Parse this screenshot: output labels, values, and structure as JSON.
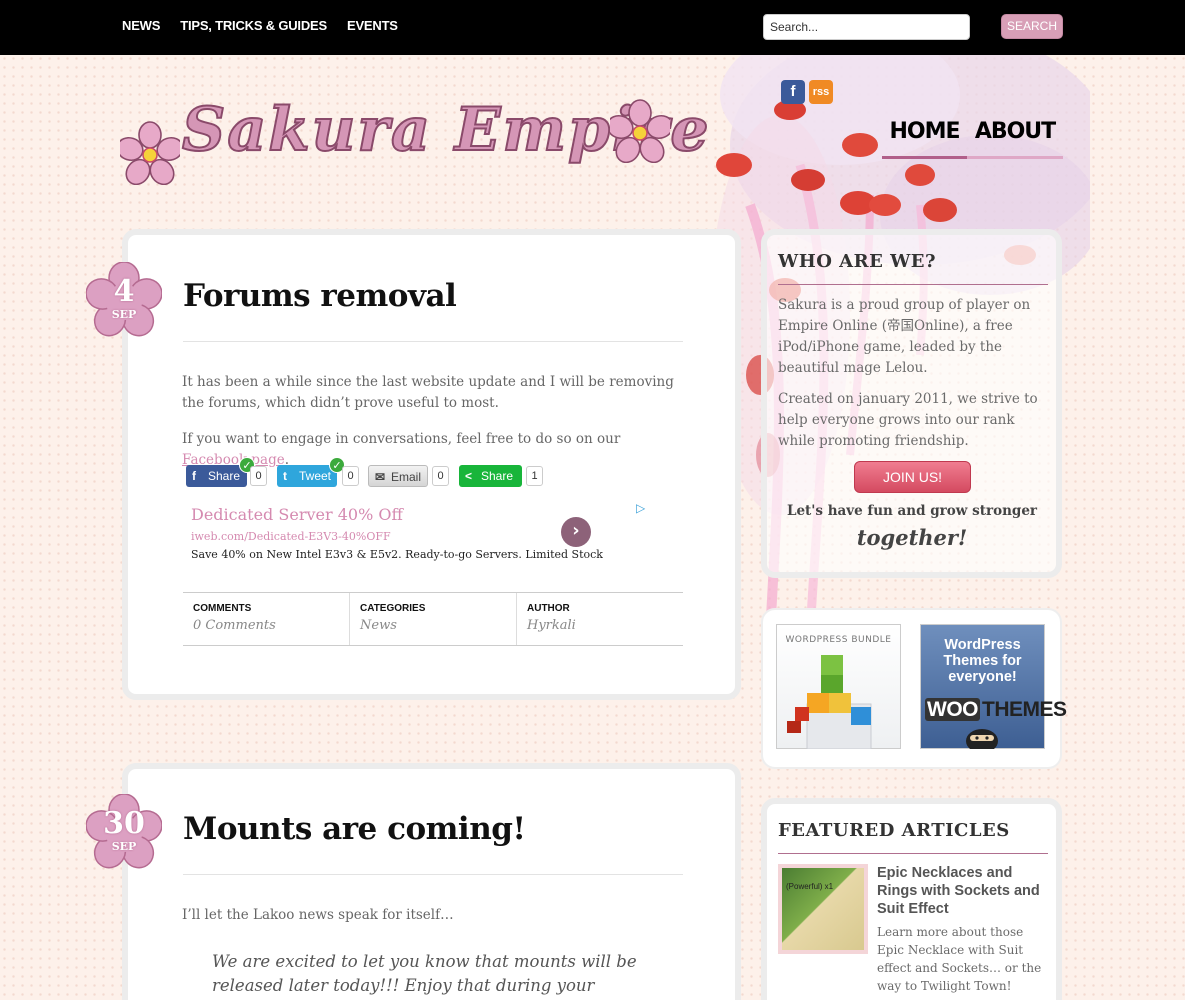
{
  "topnav": {
    "items": [
      "NEWS",
      "TIPS, TRICKS & GUIDES",
      "EVENTS"
    ]
  },
  "search": {
    "value": "Search...",
    "button": "SEARCH"
  },
  "site": {
    "logo": "Sakura Empire"
  },
  "social": {
    "facebook": "f",
    "rss": "rss"
  },
  "mainnav": {
    "home": "HOME",
    "about": "ABOUT"
  },
  "posts": [
    {
      "day": "4",
      "month": "SEP",
      "title": "Forums removal",
      "para1": "It has been a while since the last website update and I will be removing the forums, which didn’t prove useful to most.",
      "para2_prefix": "If you want to engage in conversations, feel free to do so on our ",
      "para2_link": "Facebook page",
      "para2_suffix": ".",
      "share": [
        {
          "label": "Share",
          "count": "0",
          "icon": "f",
          "color": "#3b5a9a"
        },
        {
          "label": "Tweet",
          "count": "0",
          "icon": "t",
          "color": "#2fa6dc"
        },
        {
          "label": "Email",
          "count": "0",
          "icon": "✉",
          "color": "#d9d9d9"
        },
        {
          "label": "Share",
          "count": "1",
          "icon": "<",
          "color": "#18b53a"
        }
      ],
      "ad": {
        "title": "Dedicated Server 40% Off",
        "url": "iweb.com/Dedicated-E3V3-40%OFF",
        "desc": "Save 40% on New Intel E3v3 & E5v2. Ready-to-go Servers. Limited Stock"
      },
      "meta": {
        "comments_label": "COMMENTS",
        "comments_value": "0 Comments",
        "categories_label": "CATEGORIES",
        "categories_value": "News",
        "author_label": "AUTHOR",
        "author_value": "Hyrkali"
      }
    },
    {
      "day": "30",
      "month": "SEP",
      "title": "Mounts are coming!",
      "para1": "I’ll let the Lakoo news speak for itself…",
      "quote": "We are excited to let you know that mounts will be released later today!!! Enjoy that during your weekend! Other than"
    }
  ],
  "sidebar": {
    "who": {
      "title": "WHO ARE WE?",
      "p1": "Sakura is a proud group of player on Empire Online (帝国Online), a free iPod/iPhone game, leaded by the beautiful mage Lelou.",
      "p2": "Created on january 2011, we strive to help everyone grows into our rank while promoting friendship.",
      "join": "JOIN US!",
      "fun1": "Let's have fun and grow stronger",
      "fun2": "together!"
    },
    "banners": {
      "wp_bundle": "WORDPRESS BUNDLE",
      "woo_text": "WordPress Themes for everyone!",
      "woo_logo_a": "WOO",
      "woo_logo_b": "THEMES"
    },
    "featured": {
      "title": "FEATURED ARTICLES",
      "thumb_text": "(Powerful) x1",
      "headline": "Epic Necklaces and Rings with Sockets and Suit Effect",
      "desc": "Learn more about those Epic Necklace with Suit effect and Sockets… or the way to Twilight Town!"
    }
  }
}
